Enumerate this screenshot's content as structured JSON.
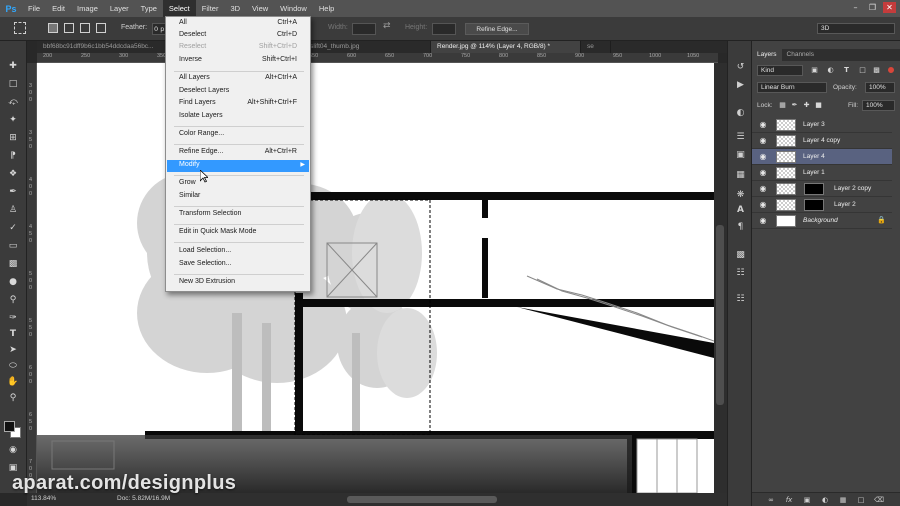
{
  "app": {
    "logo": "Ps"
  },
  "menubar": {
    "items": [
      "File",
      "Edit",
      "Image",
      "Layer",
      "Type",
      "Select",
      "Filter",
      "3D",
      "View",
      "Window",
      "Help"
    ],
    "active": "Select"
  },
  "options": {
    "feather_label": "Feather:",
    "feather_value": "0 p",
    "width_label": "Width:",
    "height_label": "Height:",
    "refine_edge_button": "Refine Edge...",
    "workspace": "3D"
  },
  "doc_tabs": [
    {
      "label": "bbf68bc91dff9b6c1bb54ddcdaa56bc..."
    },
    {
      "label": "testing-purposes_FF_Model_ID12400_1_treeslift04_thumb.jpg"
    },
    {
      "label": "Render.jpg @ 114% (Layer 4, RGB/8) *"
    },
    {
      "label": "se"
    }
  ],
  "ruler_top": [
    "200",
    "250",
    "300",
    "350",
    "400",
    "450",
    "500",
    "550",
    "600",
    "650",
    "700",
    "750",
    "800",
    "850",
    "900",
    "950",
    "1000",
    "1050"
  ],
  "ruler_left": [
    "3",
    "0",
    "0",
    "3",
    "5",
    "0",
    "4",
    "0",
    "0",
    "4",
    "5",
    "0",
    "5",
    "0",
    "0",
    "5",
    "5",
    "0",
    "6",
    "0",
    "0",
    "6",
    "5",
    "0",
    "7",
    "0",
    "0"
  ],
  "select_menu": {
    "items": [
      {
        "label": "All",
        "shortcut": "Ctrl+A"
      },
      {
        "label": "Deselect",
        "shortcut": "Ctrl+D"
      },
      {
        "label": "Reselect",
        "shortcut": "Shift+Ctrl+D",
        "disabled": true
      },
      {
        "label": "Inverse",
        "shortcut": "Shift+Ctrl+I"
      },
      {
        "label": "All Layers",
        "shortcut": "Alt+Ctrl+A"
      },
      {
        "label": "Deselect Layers",
        "shortcut": ""
      },
      {
        "label": "Find Layers",
        "shortcut": "Alt+Shift+Ctrl+F"
      },
      {
        "label": "Isolate Layers",
        "shortcut": ""
      },
      {
        "label": "Color Range...",
        "shortcut": ""
      },
      {
        "label": "Refine Edge...",
        "shortcut": "Alt+Ctrl+R"
      },
      {
        "label": "Modify",
        "shortcut": "",
        "highlighted": true,
        "submenu": true
      },
      {
        "label": "Grow",
        "shortcut": ""
      },
      {
        "label": "Similar",
        "shortcut": ""
      },
      {
        "label": "Transform Selection",
        "shortcut": ""
      },
      {
        "label": "Edit in Quick Mask Mode",
        "shortcut": ""
      },
      {
        "label": "Load Selection...",
        "shortcut": ""
      },
      {
        "label": "Save Selection...",
        "shortcut": ""
      },
      {
        "label": "New 3D Extrusion",
        "shortcut": ""
      }
    ]
  },
  "layers_panel": {
    "tabs": [
      "Layers",
      "Channels"
    ],
    "active_tab": "Layers",
    "filter_kind": "Kind",
    "blend_mode": "Linear Burn",
    "opacity_label": "Opacity:",
    "opacity": "100%",
    "lock_label": "Lock:",
    "fill_label": "Fill:",
    "fill": "100%",
    "layers": [
      {
        "name": "Layer 3",
        "selected": false,
        "mask": false
      },
      {
        "name": "Layer 4 copy",
        "selected": false,
        "mask": false
      },
      {
        "name": "Layer 4",
        "selected": true,
        "mask": false
      },
      {
        "name": "Layer 1",
        "selected": false,
        "mask": false
      },
      {
        "name": "Layer 2 copy",
        "selected": false,
        "mask": true
      },
      {
        "name": "Layer 2",
        "selected": false,
        "mask": true
      },
      {
        "name": "Background",
        "selected": false,
        "mask": false,
        "locked": true
      }
    ]
  },
  "status": {
    "zoom": "113.84%",
    "doc": "Doc: 5.82M/16.9M"
  },
  "watermark": "aparat.com/designplus",
  "colors": {
    "menu_highlight": "#3399ff",
    "selected_layer": "#596280",
    "ps_blue": "#31a8ff"
  }
}
